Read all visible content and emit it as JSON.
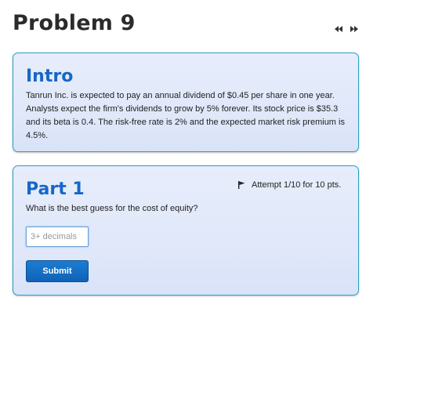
{
  "problem": {
    "title": "Problem 9"
  },
  "nav": {
    "prev_icon": "rewind-icon",
    "next_icon": "fast-forward-icon"
  },
  "intro": {
    "heading": "Intro",
    "text": "Tanrun Inc. is expected to pay an annual dividend of $0.45 per share in one year. Analysts expect the firm's dividends to grow by 5% forever. Its stock price is $35.3 and its beta is 0.4. The risk-free rate is 2% and the expected market risk premium is 4.5%."
  },
  "part1": {
    "heading": "Part 1",
    "attempt": "Attempt 1/10 for 10 pts.",
    "question": "What is the best guess for the cost of equity?",
    "input_placeholder": "3+ decimals",
    "input_value": "",
    "submit_label": "Submit"
  },
  "colors": {
    "heading_blue": "#1667c7",
    "card_border": "#2a9fc4",
    "button_blue": "#0f62b6"
  }
}
